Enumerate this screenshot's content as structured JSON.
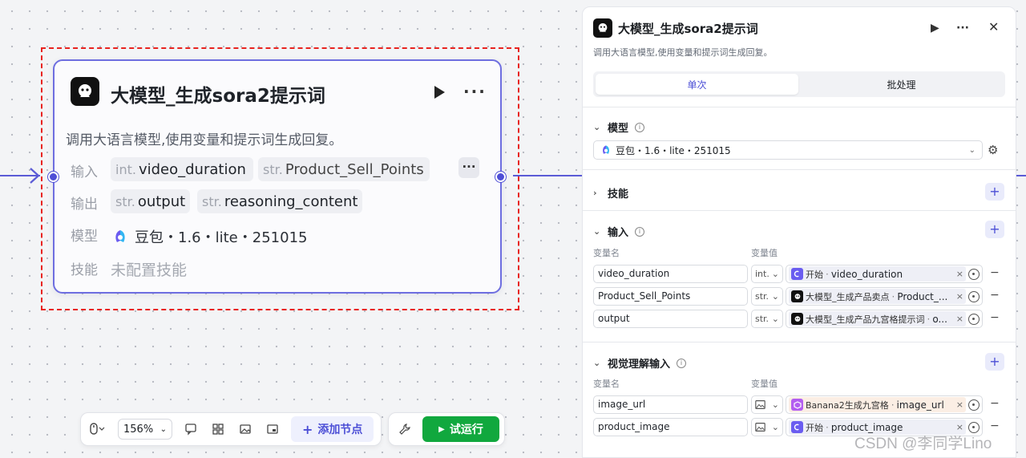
{
  "colors": {
    "accent": "#4c4fd6",
    "run": "#11a83e",
    "selection": "#e8231f"
  },
  "node": {
    "title": "大模型_生成sora2提示词",
    "description": "调用大语言模型,使用变量和提示词生成回复。",
    "input_label": "输入",
    "inputs": [
      {
        "type": "int.",
        "name": "video_duration"
      },
      {
        "type": "str.",
        "name": "Product_Sell_Points"
      }
    ],
    "output_label": "输出",
    "outputs": [
      {
        "type": "str.",
        "name": "output"
      },
      {
        "type": "str.",
        "name": "reasoning_content"
      }
    ],
    "model_label": "模型",
    "model": "豆包・1.6・lite・251015",
    "skill_label": "技能",
    "skill_value": "未配置技能",
    "icons": {
      "logo": "llm-robot-icon",
      "run": "play-icon",
      "more": "more-icon"
    }
  },
  "toolbar": {
    "zoom": "156%",
    "add_node": "添加节点",
    "test_run": "试运行",
    "icons": [
      "mouse-icon",
      "comment-icon",
      "layout-icon",
      "image-icon",
      "minimap-icon",
      "wrench-icon"
    ]
  },
  "panel": {
    "title": "大模型_生成sora2提示词",
    "description": "调用大语言模型,使用变量和提示词生成回复。",
    "tabs": [
      "单次",
      "批处理"
    ],
    "model_section": "模型",
    "model_value": "豆包・1.6・lite・251015",
    "skills_section": "技能",
    "input_section": "输入",
    "col_name": "变量名",
    "col_value": "变量值",
    "inputs": [
      {
        "name": "video_duration",
        "type": "int.",
        "source": "开始",
        "var": "video_duration",
        "color": "#6a5cf0"
      },
      {
        "name": "Product_Sell_Points",
        "type": "str.",
        "source": "大模型_生成产品卖点",
        "var": "Product_...",
        "color": "#111111"
      },
      {
        "name": "output",
        "type": "str.",
        "source": "大模型_生成产品九宫格提示词",
        "var": "o...",
        "color": "#111111"
      }
    ],
    "vision_section": "视觉理解输入",
    "vision_inputs": [
      {
        "name": "image_url",
        "source": "Banana2生成九宫格",
        "var": "image_url",
        "color": "#b35ef0"
      },
      {
        "name": "product_image",
        "source": "开始",
        "var": "product_image",
        "color": "#6a5cf0"
      }
    ]
  },
  "watermark": "CSDN @李同学Lino"
}
